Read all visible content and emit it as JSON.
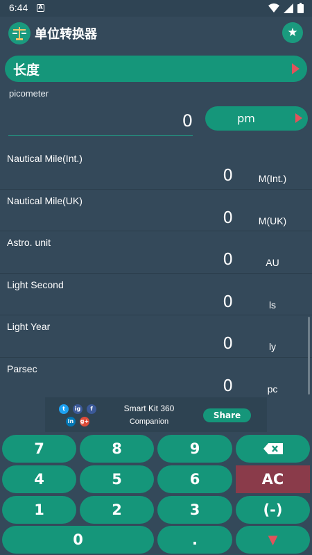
{
  "statusbar": {
    "time": "6:44",
    "notif_icon": "A"
  },
  "appbar": {
    "title": "单位转换器",
    "logo_icon": "scale-icon",
    "favorite_icon": "star-icon"
  },
  "category": {
    "label": "长度"
  },
  "source": {
    "unit_name": "picometer",
    "value": "0",
    "unit_symbol": "pm"
  },
  "results": [
    {
      "name": "Nautical Mile(Int.)",
      "value": "0",
      "unit": "M(Int.)"
    },
    {
      "name": "Nautical Mile(UK)",
      "value": "0",
      "unit": "M(UK)"
    },
    {
      "name": "Astro. unit",
      "value": "0",
      "unit": "AU"
    },
    {
      "name": "Light Second",
      "value": "0",
      "unit": "ls"
    },
    {
      "name": "Light Year",
      "value": "0",
      "unit": "ly"
    },
    {
      "name": "Parsec",
      "value": "0",
      "unit": "pc"
    }
  ],
  "ad": {
    "title": "Smart Kit 360",
    "subtitle": "Companion",
    "share_label": "Share",
    "social": {
      "twitter": "t",
      "instagram": "ig",
      "facebook": "f",
      "linkedin": "in",
      "googleplus": "g+"
    }
  },
  "keypad": {
    "k7": "7",
    "k8": "8",
    "k9": "9",
    "backspace": "⌫",
    "k4": "4",
    "k5": "5",
    "k6": "6",
    "ac": "AC",
    "k1": "1",
    "k2": "2",
    "k3": "3",
    "negate": "(-)",
    "k0": "0",
    "dot": ".",
    "down": "▼"
  },
  "colors": {
    "background": "#34495a",
    "accent": "#15967a",
    "danger": "#8a3b4a",
    "arrow": "#e2525b"
  }
}
